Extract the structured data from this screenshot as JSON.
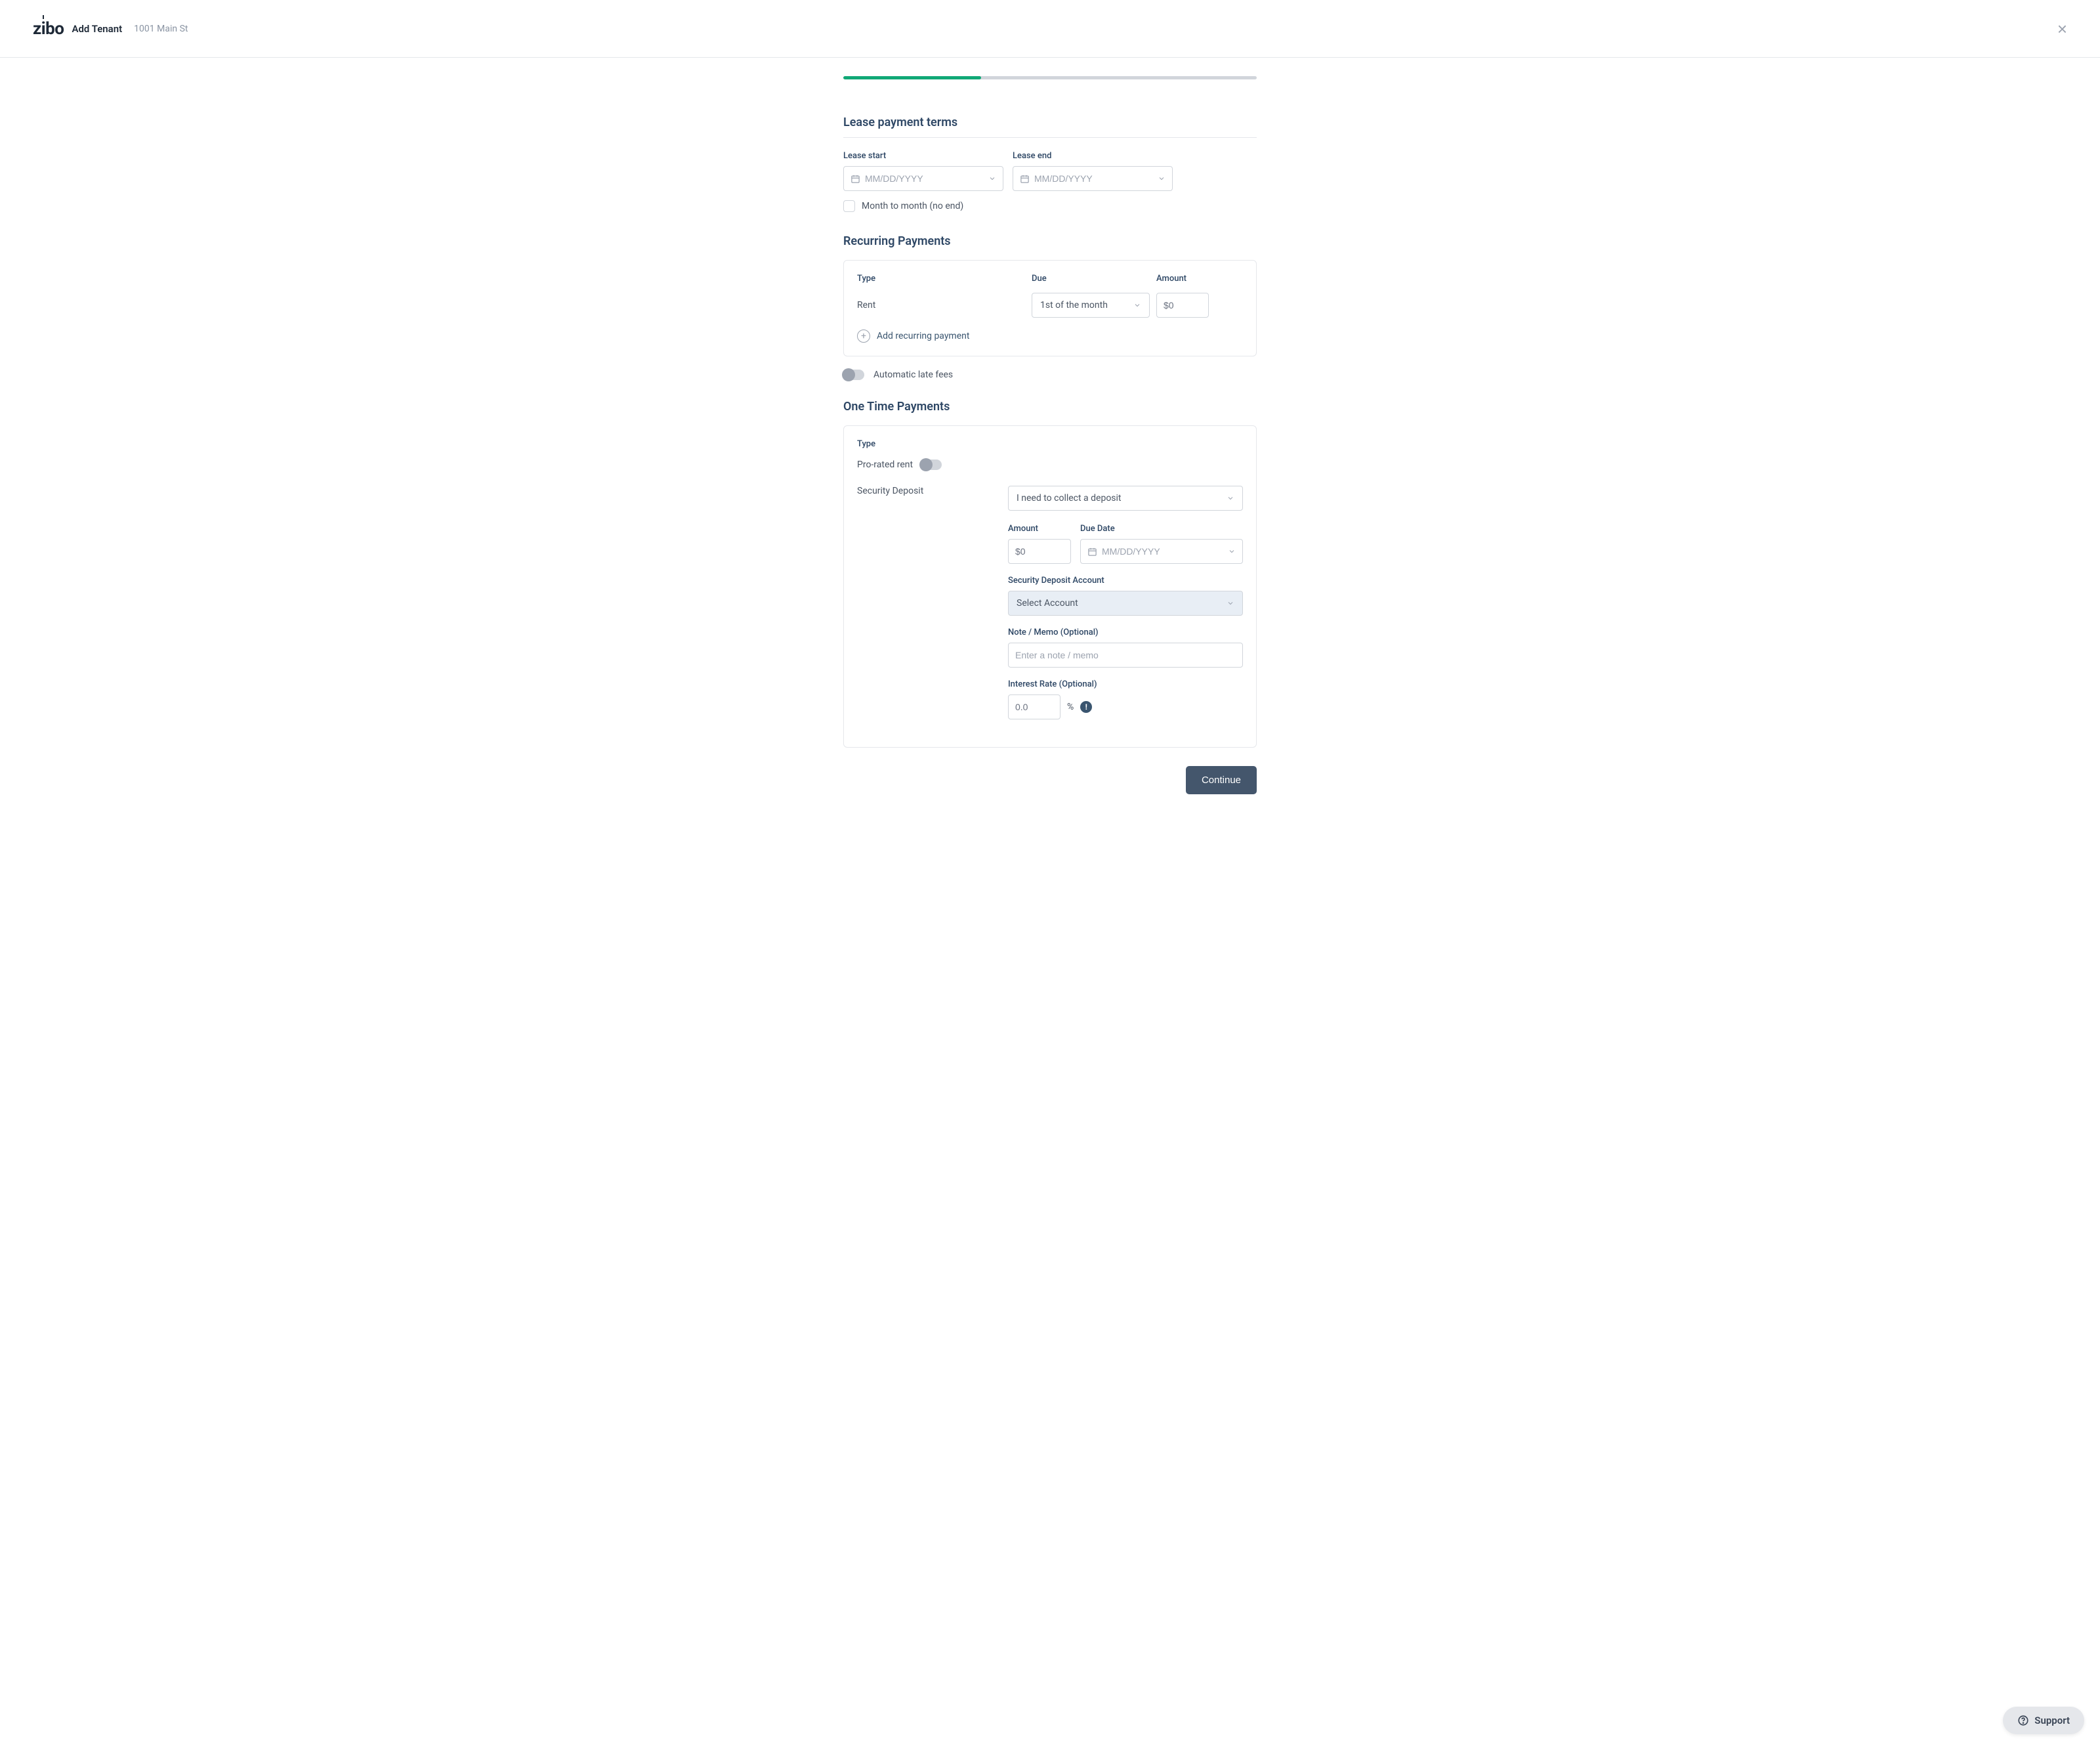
{
  "header": {
    "logo": "zibo",
    "title": "Add Tenant",
    "subtitle": "1001 Main St"
  },
  "sections": {
    "lease_terms": {
      "title": "Lease payment terms",
      "start_label": "Lease start",
      "end_label": "Lease end",
      "date_placeholder": "MM/DD/YYYY",
      "month_to_month": "Month to month (no end)"
    },
    "recurring": {
      "title": "Recurring Payments",
      "type_header": "Type",
      "due_header": "Due",
      "amount_header": "Amount",
      "rent_label": "Rent",
      "due_value": "1st of the month",
      "amount_value": "$0",
      "add_label": "Add recurring payment",
      "late_fees_label": "Automatic late fees"
    },
    "onetime": {
      "title": "One Time Payments",
      "type_header": "Type",
      "prorated_label": "Pro-rated rent",
      "deposit_label": "Security Deposit",
      "deposit_select": "I need to collect a deposit",
      "amount_label": "Amount",
      "amount_value": "$0",
      "due_date_label": "Due Date",
      "due_date_placeholder": "MM/DD/YYYY",
      "account_label": "Security Deposit Account",
      "account_value": "Select Account",
      "note_label": "Note / Memo (Optional)",
      "note_placeholder": "Enter a note / memo",
      "rate_label": "Interest Rate (Optional)",
      "rate_value": "0.0",
      "percent_symbol": "%"
    }
  },
  "footer": {
    "continue": "Continue"
  },
  "support": {
    "label": "Support"
  },
  "colors": {
    "accent": "#2e4765",
    "progress": "#10a876",
    "button": "#44566c"
  }
}
